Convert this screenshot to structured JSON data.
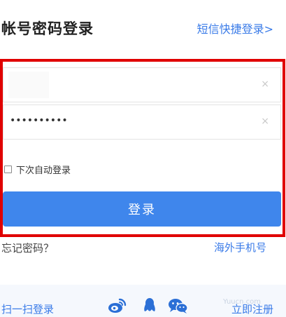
{
  "header": {
    "title": "帐号密码登录",
    "sms_login_link": "短信快捷登录>"
  },
  "form": {
    "account": {
      "value": "",
      "placeholder": "",
      "clear_glyph": "×"
    },
    "password": {
      "masked_value": "••••••••••",
      "clear_glyph": "×"
    },
    "remember_label": "下次自动登录",
    "remember_checked": false,
    "login_button": "登录"
  },
  "links": {
    "forgot_password": "忘记密码？",
    "overseas_phone": "海外手机号"
  },
  "footer": {
    "scan_login": "扫一扫登录",
    "social_icons": [
      "weibo-icon",
      "qq-icon",
      "wechat-icon"
    ],
    "register": "立即注册",
    "watermark": "Yuucn.com"
  },
  "colors": {
    "accent": "#3a7be8",
    "button": "#3f86ec",
    "highlight_border": "#e00000",
    "weibo": "#e6162d",
    "qq": "#2b6fd6",
    "wechat": "#2b6fd6"
  }
}
